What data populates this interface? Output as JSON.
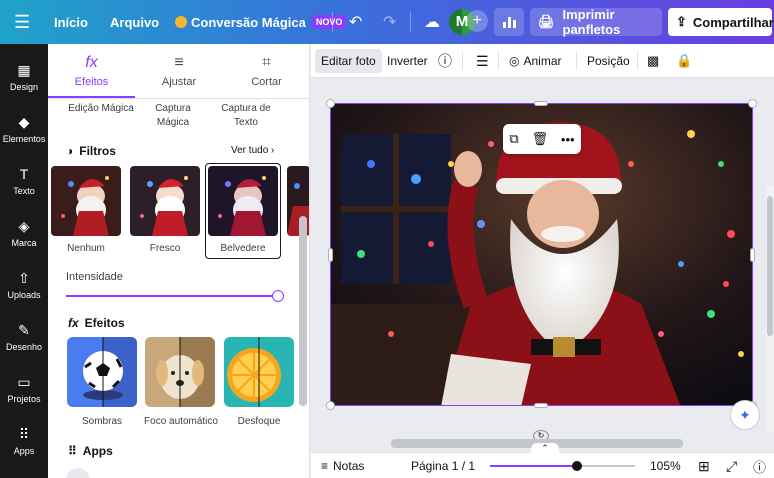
{
  "topbar": {
    "menu_icon": "menu-icon",
    "inicio": "Início",
    "arquivo": "Arquivo",
    "magic": "Conversão Mágica",
    "novo_badge": "NOVO",
    "avatar_initial": "M",
    "print_label": "Imprimir panfletos",
    "share_label": "Compartilhar"
  },
  "rail": [
    {
      "label": "Design",
      "icon": "layout-icon"
    },
    {
      "label": "Elementos",
      "icon": "shapes-icon"
    },
    {
      "label": "Texto",
      "icon": "text-icon"
    },
    {
      "label": "Marca",
      "icon": "brand-icon"
    },
    {
      "label": "Uploads",
      "icon": "upload-icon"
    },
    {
      "label": "Desenho",
      "icon": "pen-icon"
    },
    {
      "label": "Projetos",
      "icon": "folder-icon"
    },
    {
      "label": "Apps",
      "icon": "apps-icon"
    }
  ],
  "panel": {
    "tabs": [
      {
        "label": "Efeitos",
        "icon": "fx-icon"
      },
      {
        "label": "Ajustar",
        "icon": "sliders-icon"
      },
      {
        "label": "Cortar",
        "icon": "crop-icon"
      }
    ],
    "tools": [
      "Edição Mágica",
      "Captura Mágica",
      "Captura de Texto"
    ],
    "filters_title": "Filtros",
    "see_all": "Ver tudo",
    "filters": [
      "Nenhum",
      "Fresco",
      "Belvedere"
    ],
    "intensity_label": "Intensidade",
    "intensity_value": 1.0,
    "effects_title": "Efeitos",
    "effects": [
      "Sombras",
      "Foco automático",
      "Desfoque"
    ],
    "apps_title": "Apps"
  },
  "toolbar": {
    "edit_photo": "Editar foto",
    "flip": "Inverter",
    "animate": "Animar",
    "position": "Posição"
  },
  "bottom": {
    "notes": "Notas",
    "page": "Página 1 / 1",
    "zoom": "105%",
    "zoom_fraction": 0.6
  },
  "colors": {
    "accent": "#8b3dff",
    "rail_bg": "#18191b"
  }
}
